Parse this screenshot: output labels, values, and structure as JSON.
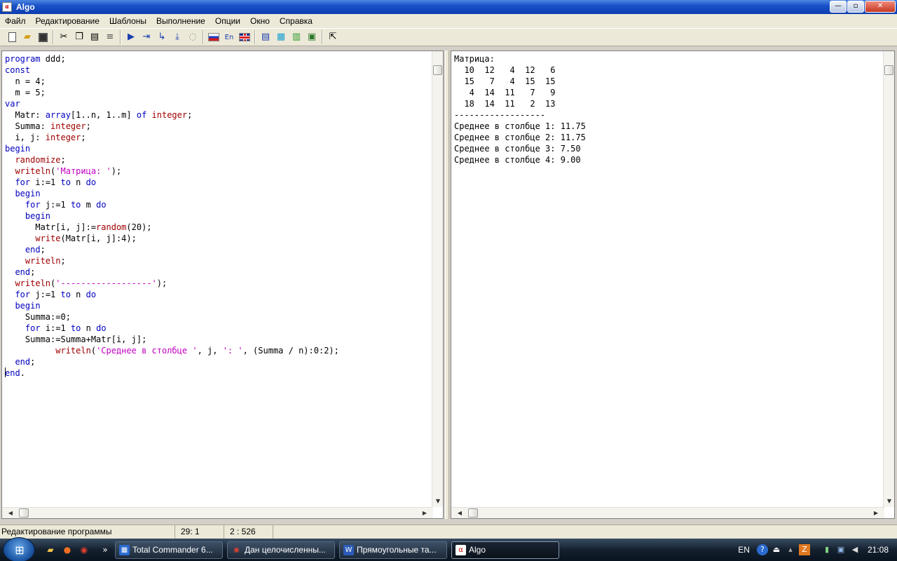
{
  "window": {
    "title": "Algo",
    "icon": "algo-app-icon"
  },
  "title_buttons": {
    "minimize": "—",
    "maximize": "▫",
    "close": "✕"
  },
  "menu": [
    "Файл",
    "Редактирование",
    "Шаблоны",
    "Выполнение",
    "Опции",
    "Окно",
    "Справка"
  ],
  "toolbar_icons": [
    "new-file-icon",
    "open-folder-icon",
    "save-icon",
    "cut-icon",
    "copy-icon",
    "paste-icon",
    "format-icon",
    "run-icon",
    "step-into-icon",
    "step-over-icon",
    "run-to-cursor-icon",
    "stop-icon",
    "russian-flag-icon",
    "en-language-icon",
    "uk-flag-icon",
    "template1-icon",
    "template2-icon",
    "template3-icon",
    "template4-icon",
    "help-pointer-icon"
  ],
  "toolbar_en_label": "En",
  "code_lines": [
    "program ddd;",
    "const",
    "  n = 4;",
    "  m = 5;",
    "var",
    "  Matr: array[1..n, 1..m] of integer;",
    "  Summa: integer;",
    "  i, j: integer;",
    "begin",
    "  randomize;",
    "  writeln('Матрица: ');",
    "  for i:=1 to n do",
    "  begin",
    "    for j:=1 to m do",
    "    begin",
    "      Matr[i, j]:=random(20);",
    "      write(Matr[i, j]:4);",
    "    end;",
    "    writeln;",
    "  end;",
    "  writeln('------------------');",
    "  for j:=1 to n do",
    "  begin",
    "    Summa:=0;",
    "    for i:=1 to n do",
    "    Summa:=Summa+Matr[i, j];",
    "          writeln('Среднее в столбце ', j, ': ', (Summa / n):0:2);",
    "  end;",
    "end."
  ],
  "output_lines": [
    "Матрица:",
    "  10  12   4  12   6",
    "  15   7   4  15  15",
    "   4  14  11   7   9",
    "  18  14  11   2  13",
    "------------------",
    "Среднее в столбце 1: 11.75",
    "Среднее в столбце 2: 11.75",
    "Среднее в столбце 3: 7.50",
    "Среднее в столбце 4: 9.00"
  ],
  "status": {
    "mode": "Редактирование программы",
    "cursor": "29:  1",
    "position": "2 : 526"
  },
  "taskbar": {
    "start_glyph": "⊞",
    "quick_launch": [
      "folder-icon",
      "firefox-icon",
      "chrome-icon"
    ],
    "more": "»",
    "buttons": [
      {
        "label": "Total Commander 6...",
        "icon": "total-commander-icon",
        "glyph": "▦",
        "color": "#2a6ad0"
      },
      {
        "label": "Дан целочисленны...",
        "icon": "chrome-icon",
        "glyph": "◉",
        "color": "#e04030"
      },
      {
        "label": "Прямоугольные та...",
        "icon": "word-icon",
        "glyph": "W",
        "color": "#2a5bb8"
      },
      {
        "label": "Algo",
        "icon": "algo-app-icon",
        "glyph": "α",
        "color": "#c00"
      }
    ],
    "tray": {
      "lang": "EN",
      "time": "21:08"
    }
  }
}
